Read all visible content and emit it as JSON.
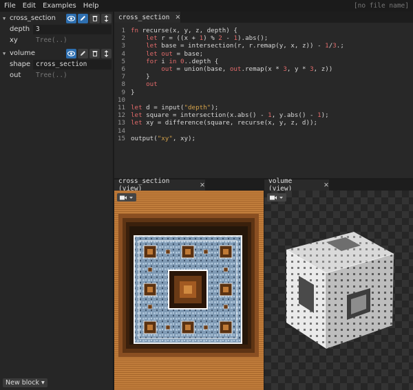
{
  "menu": {
    "items": [
      "File",
      "Edit",
      "Examples",
      "Help"
    ],
    "file_name": "[no file name]"
  },
  "blocks": [
    {
      "name": "cross_section",
      "fields": [
        {
          "label": "depth",
          "value": "3",
          "placeholder": false
        },
        {
          "label": "xy",
          "value": "Tree(..)",
          "placeholder": true
        }
      ]
    },
    {
      "name": "volume",
      "fields": [
        {
          "label": "shape",
          "value": "cross_section",
          "placeholder": false
        },
        {
          "label": "out",
          "value": "Tree(..)",
          "placeholder": true
        }
      ]
    }
  ],
  "new_block_label": "New block ▾",
  "editor_tab": "cross_section",
  "code": [
    {
      "n": "1",
      "t": "fn recurse(x, y, z, depth) {"
    },
    {
      "n": "2",
      "t": "    let r = ((x + 1) % 2 - 1).abs();"
    },
    {
      "n": "3",
      "t": "    let base = intersection(r, r.remap(y, x, z)) - 1/3.;"
    },
    {
      "n": "4",
      "t": "    let out = base;"
    },
    {
      "n": "5",
      "t": "    for i in 0..depth {"
    },
    {
      "n": "6",
      "t": "        out = union(base, out.remap(x * 3, y * 3, z))"
    },
    {
      "n": "7",
      "t": "    }"
    },
    {
      "n": "8",
      "t": "    out"
    },
    {
      "n": "9",
      "t": "}"
    },
    {
      "n": "10",
      "t": ""
    },
    {
      "n": "11",
      "t": "let d = input(\"depth\");"
    },
    {
      "n": "12",
      "t": "let square = intersection(x.abs() - 1, y.abs() - 1);"
    },
    {
      "n": "13",
      "t": "let xy = difference(square, recurse(x, y, z, d));"
    },
    {
      "n": "14",
      "t": ""
    },
    {
      "n": "15",
      "t": "output(\"xy\", xy);"
    }
  ],
  "viewports": [
    {
      "tab": "cross_section (view)"
    },
    {
      "tab": "volume (view)"
    }
  ],
  "colors": {
    "accent": "#2e6fb0",
    "keyword": "#e06a6a",
    "string": "#d4a24a",
    "number": "#e06a6a",
    "orange": "#c68642"
  }
}
